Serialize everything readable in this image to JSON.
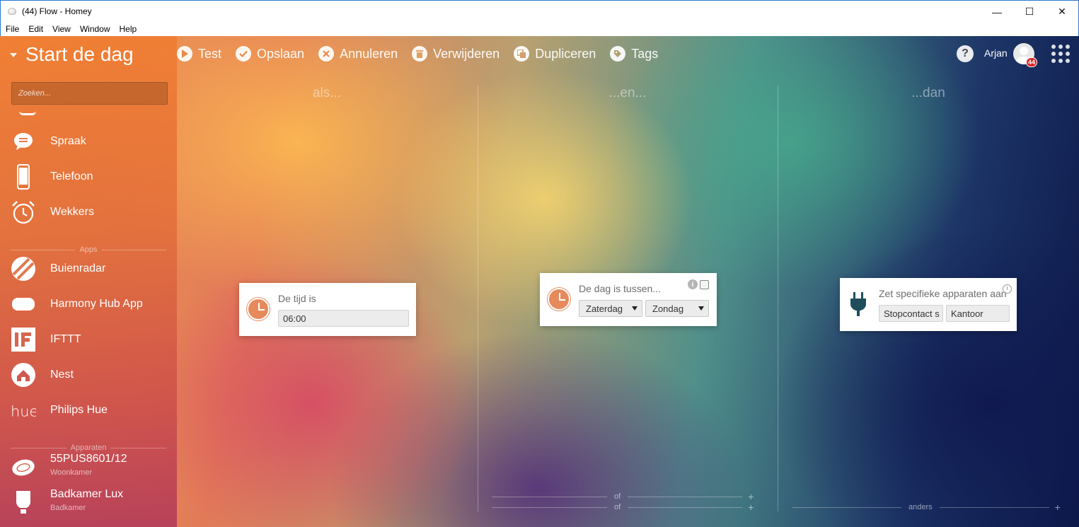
{
  "window": {
    "title": "(44) Flow - Homey",
    "minimize": "—",
    "maximize": "☐",
    "close": "✕"
  },
  "menubar": [
    "File",
    "Edit",
    "Window",
    "Help"
  ],
  "sidebar": {
    "flow_name": "Start de dag",
    "search_placeholder": "Zoeken...",
    "system_items": [
      {
        "label": "Spraak",
        "icon": "chat-bubble-icon"
      },
      {
        "label": "Telefoon",
        "icon": "phone-icon"
      },
      {
        "label": "Wekkers",
        "icon": "alarm-clock-icon"
      }
    ],
    "apps_header": "Apps",
    "apps": [
      {
        "label": "Buienradar",
        "icon": "buienradar-icon"
      },
      {
        "label": "Harmony Hub App",
        "icon": "harmony-icon"
      },
      {
        "label": "IFTTT",
        "icon": "ifttt-icon"
      },
      {
        "label": "Nest",
        "icon": "nest-icon"
      },
      {
        "label": "Philips Hue",
        "icon": "hue-icon"
      }
    ],
    "devices_header": "Apparaten",
    "devices": [
      {
        "label": "55PUS8601/12",
        "zone": "Woonkamer",
        "icon": "tv-icon"
      },
      {
        "label": "Badkamer Lux",
        "zone": "Badkamer",
        "icon": "lightbulb-icon"
      }
    ]
  },
  "toolbar": {
    "test": "Test",
    "save": "Opslaan",
    "cancel": "Annuleren",
    "delete": "Verwijderen",
    "duplicate": "Dupliceren",
    "tags": "Tags",
    "help": "?",
    "user": "Arjan",
    "notification_count": "44"
  },
  "columns": {
    "when": "als...",
    "and": "...en...",
    "then": "...dan",
    "or_label": "of",
    "else_label": "anders",
    "plus": "+"
  },
  "cards": {
    "trigger": {
      "title": "De tijd is",
      "value": "06:00"
    },
    "condition": {
      "title": "De dag is tussen...",
      "from": "Zaterdag",
      "to": "Zondag",
      "info": "i"
    },
    "action": {
      "title": "Zet specifieke apparaten aan",
      "device": "Stopcontact s",
      "zone": "Kantoor"
    }
  },
  "colors": {
    "clock_accent": "#e68a5c",
    "plug_icon": "#1e4e5c",
    "badge": "#e02020"
  }
}
